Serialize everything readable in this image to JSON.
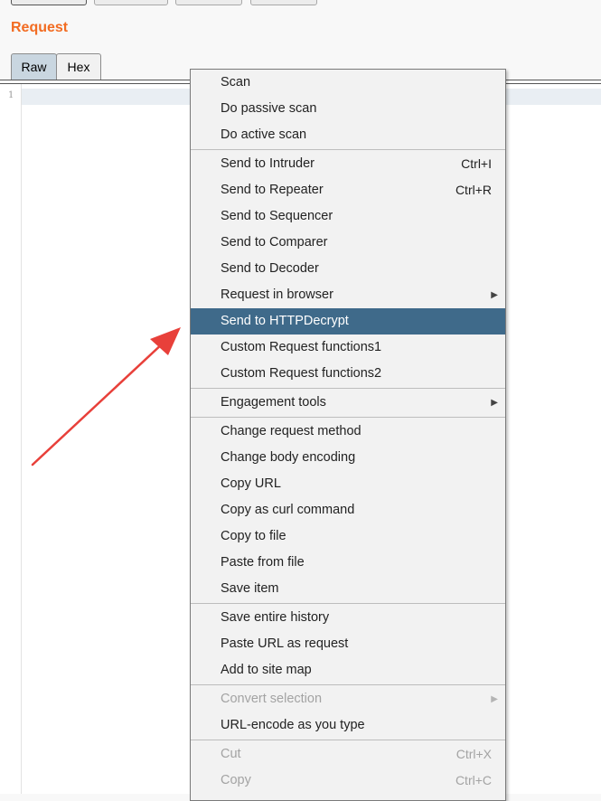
{
  "request_panel": {
    "title": "Request",
    "tabs": [
      "Raw",
      "Hex"
    ],
    "line_number": "1"
  },
  "context_menu": {
    "items": [
      {
        "label": "Scan"
      },
      {
        "label": "Do passive scan"
      },
      {
        "label": "Do active scan"
      },
      {
        "label": "Send to Intruder",
        "shortcut": "Ctrl+I"
      },
      {
        "label": "Send to Repeater",
        "shortcut": "Ctrl+R"
      },
      {
        "label": "Send to Sequencer"
      },
      {
        "label": "Send to Comparer"
      },
      {
        "label": "Send to Decoder"
      },
      {
        "label": "Request in browser",
        "submenu": "▶"
      },
      {
        "label": "Send to HTTPDecrypt",
        "selected": true
      },
      {
        "label": "Custom Request functions1"
      },
      {
        "label": "Custom Request functions2"
      },
      {
        "label": "Engagement tools",
        "submenu": "▶"
      },
      {
        "label": "Change request method"
      },
      {
        "label": "Change body encoding"
      },
      {
        "label": "Copy URL"
      },
      {
        "label": "Copy as curl command"
      },
      {
        "label": "Copy to file"
      },
      {
        "label": "Paste from file"
      },
      {
        "label": "Save item"
      },
      {
        "label": "Save entire history"
      },
      {
        "label": "Paste URL as request"
      },
      {
        "label": "Add to site map"
      },
      {
        "label": "Convert selection",
        "submenu": "▶",
        "disabled": true
      },
      {
        "label": "URL-encode as you type"
      },
      {
        "label": "Cut",
        "shortcut": "Ctrl+X",
        "disabled": true
      },
      {
        "label": "Copy",
        "shortcut": "Ctrl+C",
        "disabled": true
      }
    ]
  },
  "colors": {
    "accent_title": "#f26c22",
    "menu_selected": "#3f6a8a",
    "annotation_arrow": "#e8403a"
  }
}
